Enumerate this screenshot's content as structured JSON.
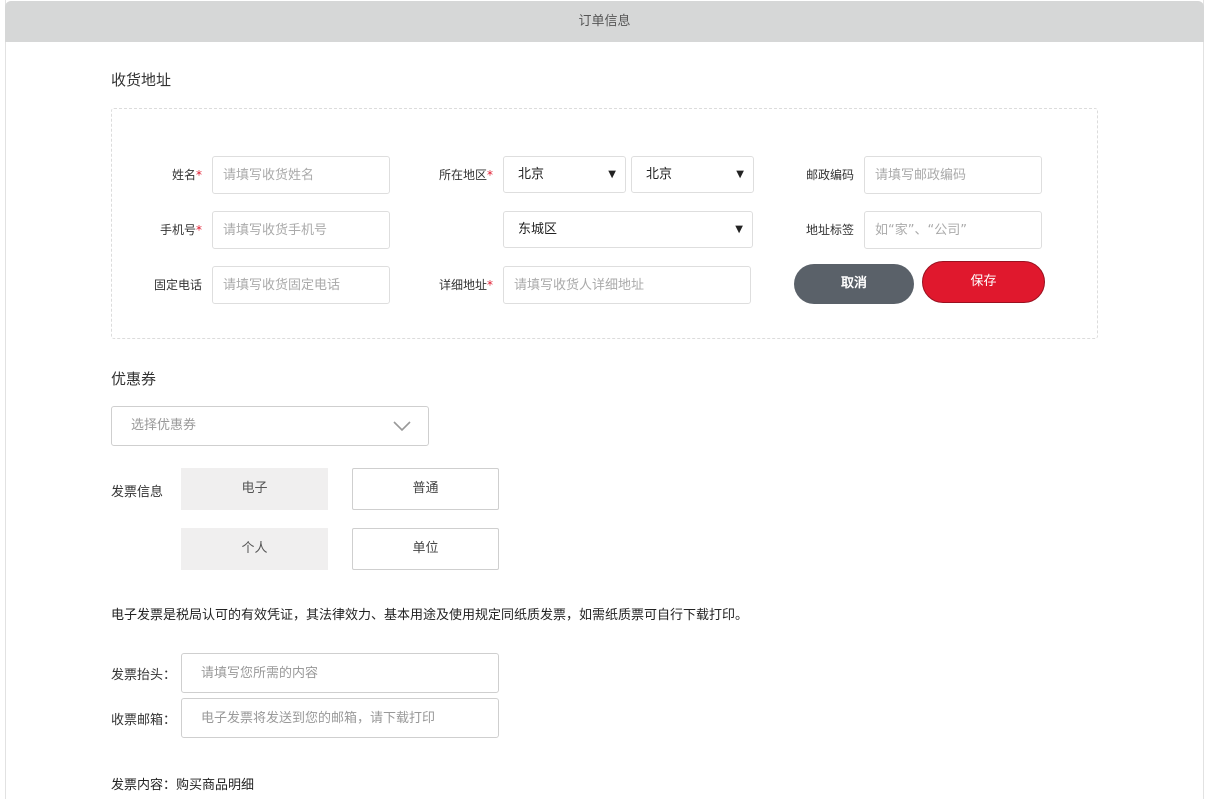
{
  "header": {
    "title": "订单信息"
  },
  "address": {
    "section_title": "收货地址",
    "name_label": "姓名",
    "name_placeholder": "请填写收货姓名",
    "phone_label": "手机号",
    "phone_placeholder": "请填写收货手机号",
    "landline_label": "固定电话",
    "landline_placeholder": "请填写收货固定电话",
    "region_label": "所在地区",
    "province": "北京",
    "city": "北京",
    "district": "东城区",
    "detail_label": "详细地址",
    "detail_placeholder": "请填写收货人详细地址",
    "postal_label": "邮政编码",
    "postal_placeholder": "请填写邮政编码",
    "tag_label": "地址标签",
    "tag_placeholder": "如“家”、“公司”",
    "required_mark": "*",
    "cancel_label": "取消",
    "save_label": "保存"
  },
  "coupon": {
    "section_title": "优惠券",
    "placeholder": "选择优惠券"
  },
  "invoice": {
    "label": "发票信息",
    "type_options": [
      "电子",
      "普通"
    ],
    "holder_options": [
      "个人",
      "单位"
    ],
    "notice": "电子发票是税局认可的有效凭证，其法律效力、基本用途及使用规定同纸质发票，如需纸质票可自行下载打印。",
    "title_label": "发票抬头：",
    "title_placeholder": "请填写您所需的内容",
    "email_label": "收票邮箱：",
    "email_placeholder": "电子发票将发送到您的邮箱，请下载打印",
    "content_line": "发票内容：购买商品明细"
  },
  "colors": {
    "accent": "#e0182d",
    "cancel": "#5a6169",
    "header_bg": "#d6d7d7"
  }
}
